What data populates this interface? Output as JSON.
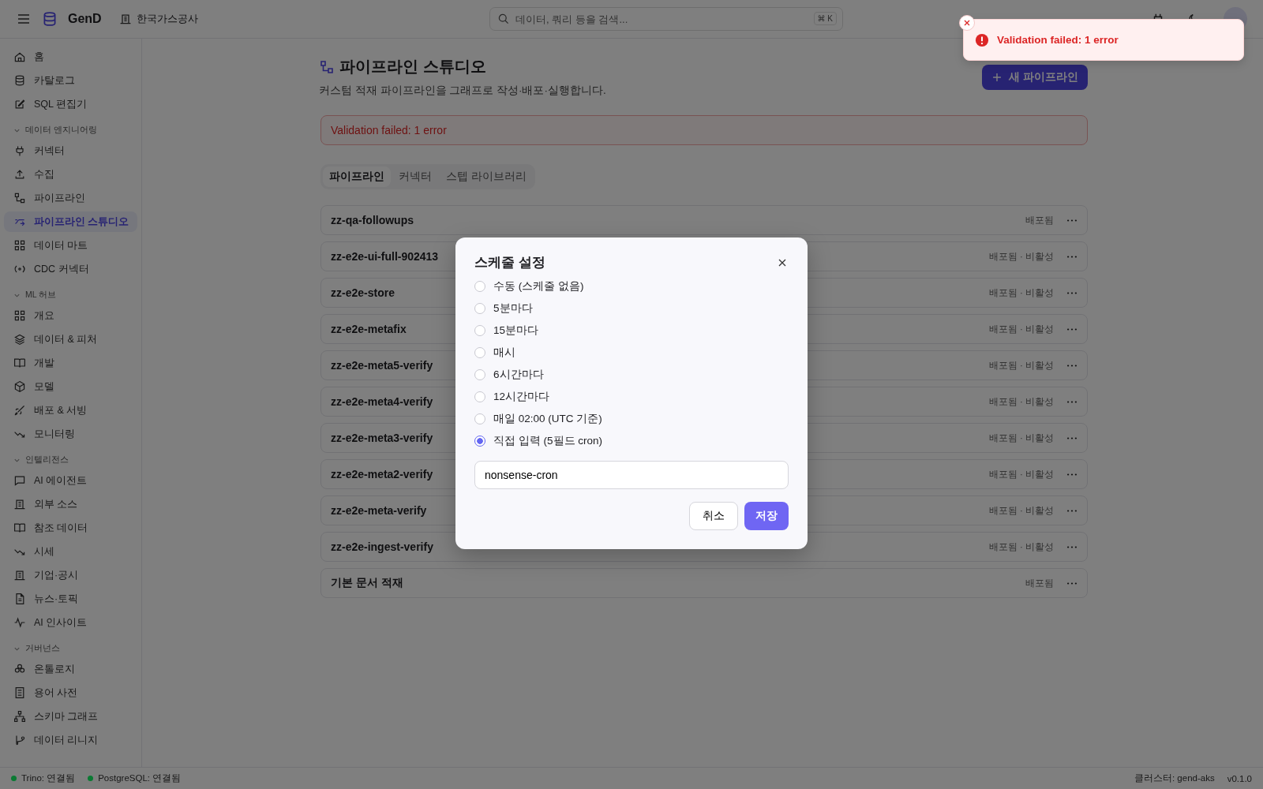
{
  "topbar": {
    "brand": "GenD",
    "org": "한국가스공사",
    "search": {
      "placeholder": "데이터, 쿼리 등을 검색...",
      "shortcut": "⌘ K"
    }
  },
  "sidebar": {
    "items": [
      {
        "label": "홈",
        "selected": false
      },
      {
        "label": "카탈로그",
        "selected": false
      },
      {
        "label": "SQL 편집기",
        "selected": false
      }
    ],
    "sections": [
      {
        "title": "데이터 엔지니어링",
        "expanded": true,
        "items": [
          {
            "label": "커넥터",
            "selected": false
          },
          {
            "label": "수집",
            "selected": false
          },
          {
            "label": "파이프라인",
            "selected": false
          },
          {
            "label": "파이프라인 스튜디오",
            "selected": true
          },
          {
            "label": "데이터 마트",
            "selected": false
          },
          {
            "label": "CDC 커넥터",
            "selected": false
          }
        ]
      },
      {
        "title": "ML 허브",
        "expanded": true,
        "items": [
          {
            "label": "개요",
            "selected": false
          },
          {
            "label": "데이터 & 피처",
            "selected": false
          },
          {
            "label": "개발",
            "selected": false
          },
          {
            "label": "모델",
            "selected": false
          },
          {
            "label": "배포 & 서빙",
            "selected": false
          },
          {
            "label": "모니터링",
            "selected": false
          }
        ]
      },
      {
        "title": "인텔리전스",
        "expanded": true,
        "items": [
          {
            "label": "AI 에이전트",
            "selected": false
          },
          {
            "label": "외부 소스",
            "selected": false
          },
          {
            "label": "참조 데이터",
            "selected": false
          },
          {
            "label": "시세",
            "selected": false
          },
          {
            "label": "기업·공시",
            "selected": false
          },
          {
            "label": "뉴스·토픽",
            "selected": false
          },
          {
            "label": "AI 인사이트",
            "selected": false
          }
        ]
      },
      {
        "title": "거버넌스",
        "expanded": true,
        "items": [
          {
            "label": "온톨로지",
            "selected": false
          },
          {
            "label": "용어 사전",
            "selected": false
          },
          {
            "label": "스키마 그래프",
            "selected": false
          },
          {
            "label": "데이터 리니지",
            "selected": false
          }
        ]
      }
    ]
  },
  "page": {
    "title": "파이프라인 스튜디오",
    "subtitle": "커스텀 적재 파이프라인을 그래프로 작성·배포·실행합니다.",
    "new_button": "새 파이프라인",
    "alert": "Validation failed: 1 error",
    "tabs": [
      {
        "label": "파이프라인",
        "selected": true
      },
      {
        "label": "커넥터",
        "selected": false
      },
      {
        "label": "스텝 라이브러리",
        "selected": false
      }
    ],
    "pipelines": [
      {
        "name": "zz-qa-followups",
        "status": "배포됨"
      },
      {
        "name": "zz-e2e-ui-full-902413",
        "status": "배포됨 · 비활성"
      },
      {
        "name": "zz-e2e-store",
        "status": "배포됨 · 비활성"
      },
      {
        "name": "zz-e2e-metafix",
        "status": "배포됨 · 비활성"
      },
      {
        "name": "zz-e2e-meta5-verify",
        "status": "배포됨 · 비활성"
      },
      {
        "name": "zz-e2e-meta4-verify",
        "status": "배포됨 · 비활성"
      },
      {
        "name": "zz-e2e-meta3-verify",
        "status": "배포됨 · 비활성"
      },
      {
        "name": "zz-e2e-meta2-verify",
        "status": "배포됨 · 비활성"
      },
      {
        "name": "zz-e2e-meta-verify",
        "status": "배포됨 · 비활성"
      },
      {
        "name": "zz-e2e-ingest-verify",
        "status": "배포됨 · 비활성"
      },
      {
        "name": "기본 문서 적재",
        "status": "배포됨"
      }
    ]
  },
  "dialog": {
    "title": "스케줄 설정",
    "options": [
      {
        "label": "수동 (스케줄 없음)",
        "selected": false
      },
      {
        "label": "5분마다",
        "selected": false
      },
      {
        "label": "15분마다",
        "selected": false
      },
      {
        "label": "매시",
        "selected": false
      },
      {
        "label": "6시간마다",
        "selected": false
      },
      {
        "label": "12시간마다",
        "selected": false
      },
      {
        "label": "매일 02:00 (UTC 기준)",
        "selected": false
      },
      {
        "label": "직접 입력 (5필드 cron)",
        "selected": true
      }
    ],
    "cron_value": "nonsense-cron",
    "cancel": "취소",
    "save": "저장"
  },
  "toast": {
    "message": "Validation failed: 1 error"
  },
  "status_bar": {
    "connections": [
      {
        "label": "Trino: 연결됨",
        "color": "#0b7a33"
      },
      {
        "label": "PostgreSQL: 연결됨",
        "color": "#0b7a33"
      }
    ],
    "cluster": "클러스터: gend-aks",
    "version": "v0.1.0"
  }
}
